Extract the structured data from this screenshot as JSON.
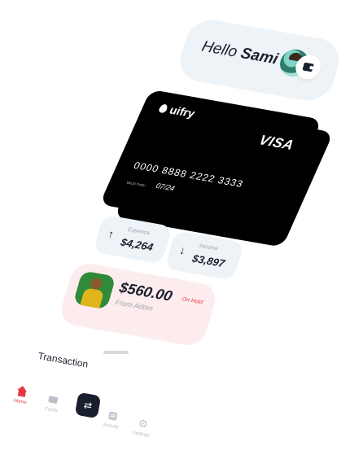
{
  "header": {
    "greeting": "Hello",
    "user_name": "Sami"
  },
  "card": {
    "brand": "uifry",
    "network": "VISA",
    "number": "0000 8888 2222 3333",
    "valid_label": "VALID THRU",
    "valid_value": "07/24"
  },
  "stats": {
    "expense": {
      "label": "Expence",
      "value": "$4,264"
    },
    "income": {
      "label": "Income",
      "value": "$3,897"
    }
  },
  "payment": {
    "amount": "$560.00",
    "from": "From Adom",
    "status": "On Hold"
  },
  "section": {
    "title": "Transaction"
  },
  "nav": {
    "home": "Home",
    "cards": "Cards",
    "activity": "Activity",
    "settings": "Settings"
  },
  "colors": {
    "accent": "#e53945",
    "dark": "#1a1f2e",
    "surface": "#eef3f7",
    "payment_surface": "#fdecee"
  },
  "icons": {
    "wallet": "wallet-icon",
    "arrow_up": "arrow-up-icon",
    "arrow_down": "arrow-down-icon",
    "home": "home-icon",
    "cards": "card-icon",
    "transfer": "transfer-icon",
    "activity": "activity-icon",
    "settings": "gear-icon"
  }
}
